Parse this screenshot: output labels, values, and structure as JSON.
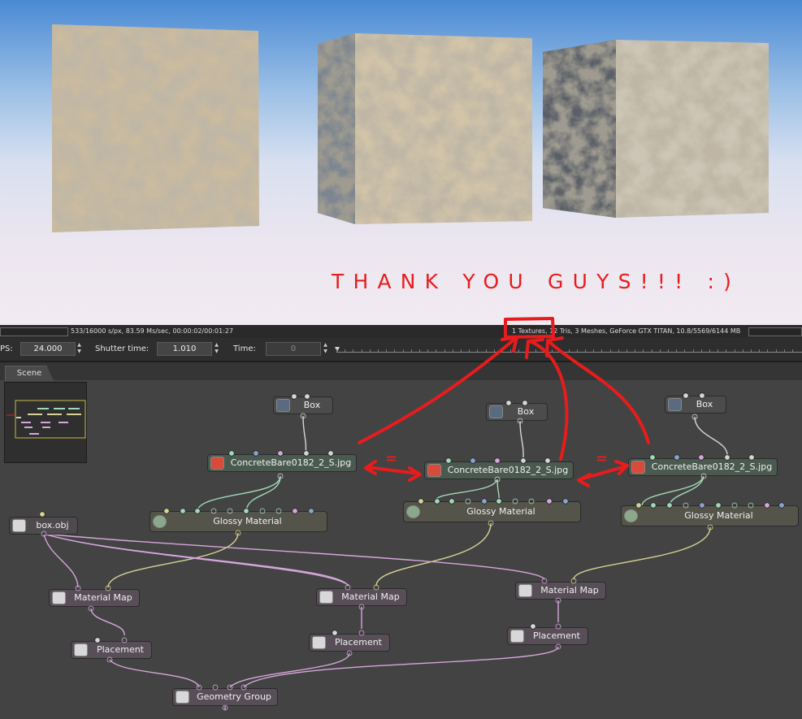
{
  "viewport": {
    "message": "THANK YOU GUYS!!! :)"
  },
  "status": {
    "render_stats": "533/16000 s/px, 83.59 Ms/sec, 00:00:02/00:01:27",
    "scene_stats": "1 Textures, 12 Tris, 3 Meshes, GeForce GTX TITAN, 10.8/5569/6144 MB"
  },
  "toolbar": {
    "fps_label": "PS:",
    "fps_value": "24.000",
    "shutter_label": "Shutter time:",
    "shutter_value": "1.010",
    "time_label": "Time:",
    "time_value": "0"
  },
  "graph": {
    "tab_label": "Scene",
    "nodes": {
      "box_obj": "box.obj",
      "box_1": "Box",
      "box_2": "Box",
      "box_3": "Box",
      "texture_1": "ConcreteBare0182_2_S.jpg",
      "texture_2": "ConcreteBare0182_2_S.jpg",
      "texture_3": "ConcreteBare0182_2_S.jpg",
      "material_1": "Glossy Material",
      "material_2": "Glossy Material",
      "material_3": "Glossy Material",
      "material_map_1": "Material Map",
      "material_map_2": "Material Map",
      "material_map_3": "Material Map",
      "placement_1": "Placement",
      "placement_2": "Placement",
      "placement_3": "Placement",
      "geometry_group": "Geometry Group"
    },
    "annotation_marks": [
      "=",
      "="
    ]
  },
  "colors": {
    "annotation_red": "#e81c1c",
    "wire_green": "#9fd9b8",
    "wire_yellow": "#d6d394",
    "wire_pink": "#d7a6dc",
    "wire_white": "#d6d6d6"
  }
}
